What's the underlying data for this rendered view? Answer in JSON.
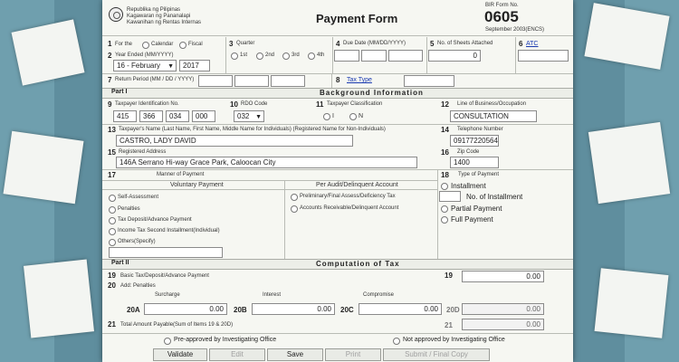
{
  "header": {
    "agency_line1": "Republika ng Pilipinas",
    "agency_line2": "Kagawaran ng Pananalapi",
    "agency_line3": "Kawanihan ng Rentas Internas",
    "title": "Payment Form",
    "form_no_label": "BIR Form No.",
    "form_no": "0605",
    "form_date": "September 2003(ENCS)"
  },
  "row1": {
    "for_the_label": "For the",
    "calendar_label": "Calendar",
    "fiscal_label": "Fiscal",
    "quarter_label": "Quarter",
    "q1": "1st",
    "q2": "2nd",
    "q3": "3rd",
    "q4": "4th",
    "due_date_label": "Due Date (MM/DD/YYYY)",
    "sheets_label": "No. of Sheets Attached",
    "sheets_value": "0",
    "atc_label": "ATC"
  },
  "year_ended": {
    "label": "Year Ended (MM/YYYY)",
    "month_value": "16 - February",
    "year_value": "2017"
  },
  "return_period": {
    "label": "Return Period (MM / DD / YYYY)",
    "tax_type_label": "Tax Type"
  },
  "part1": {
    "part_label": "Part I",
    "title": "Background Information",
    "tin_label": "Taxpayer Identification No.",
    "tin": [
      "415",
      "366",
      "034",
      "000"
    ],
    "rdo_label": "RDO Code",
    "rdo_value": "032",
    "classification_label": "Taxpayer Classification",
    "class_i": "I",
    "class_n": "N",
    "business_label": "Line of Business/Occupation",
    "business_value": "CONSULTATION",
    "name_label": "Taxpayer's Name (Last Name, First Name, Middle Name for Individuals) (Registered Name for Non-Individuals)",
    "name_value": "CASTRO, LADY DAVID",
    "phone_label": "Telephone Number",
    "phone_value": "09177220564",
    "address_label": "Registered Address",
    "address_value": "146A Serrano Hi-way Grace Park, Caloocan City",
    "zip_label": "Zip Code",
    "zip_value": "1400"
  },
  "payment": {
    "manner_label": "Manner of Payment",
    "voluntary_label": "Voluntary Payment",
    "voluntary_options": [
      "Self-Assessment",
      "Penalties",
      "Tax Deposit/Advance Payment",
      "Income Tax Second Installment(Individual)",
      "Others(Specify)"
    ],
    "audit_label": "Per Audit/Delinquent Account",
    "audit_options": [
      "Preliminary/Final Assess/Deficiency Tax",
      "Accounts Receivable/Delinquent Account"
    ],
    "type_label": "Type of Payment",
    "installment_label": "Installment",
    "no_installment_label": "No. of Installment",
    "partial_label": "Partial Payment",
    "full_label": "Full Payment"
  },
  "part2": {
    "part_label": "Part II",
    "title": "Computation of Tax",
    "basic_label": "Basic Tax/Deposit/Advance Payment",
    "basic_value": "0.00",
    "add_penalties_label": "Add: Penalties",
    "surcharge_label": "Surcharge",
    "interest_label": "Interest",
    "compromise_label": "Compromise",
    "c20a_label": "20A",
    "c20a_value": "0.00",
    "c20b_label": "20B",
    "c20b_value": "0.00",
    "c20c_label": "20C",
    "c20c_value": "0.00",
    "c20d_label": "20D",
    "c20d_value": "0.00",
    "total_label": "Total Amount Payable(Sum of Items 19 & 20D)",
    "total_value": "0.00"
  },
  "footer": {
    "preapproved_label": "Pre-approved by Investigating Office",
    "not_approved_label": "Not approved by Investigating Office"
  },
  "buttons": {
    "validate": "Validate",
    "edit": "Edit",
    "save": "Save",
    "print": "Print",
    "submit": "Submit / Final Copy"
  },
  "item_numbers": {
    "n1": "1",
    "n2": "2",
    "n3": "3",
    "n4": "4",
    "n5": "5",
    "n6": "6",
    "n7": "7",
    "n8": "8",
    "n9": "9",
    "n10": "10",
    "n11": "11",
    "n12": "12",
    "n13": "13",
    "n14": "14",
    "n15": "15",
    "n16": "16",
    "n17": "17",
    "n18": "18",
    "n19": "19",
    "n20": "20",
    "n21": "21"
  }
}
